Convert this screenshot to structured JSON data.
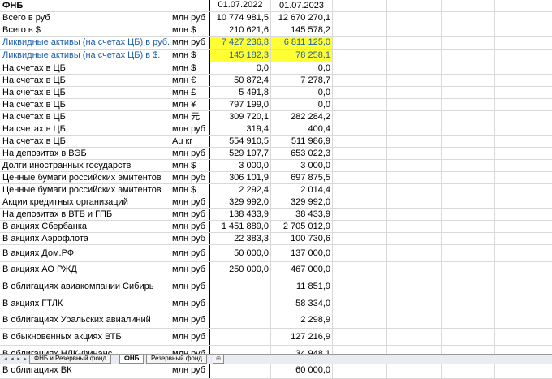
{
  "header": {
    "title": "ФНБ",
    "col1": "01.07.2022",
    "col2": "01.07.2023"
  },
  "rows": [
    {
      "label": "Всего в руб",
      "unit": "млн руб",
      "v1": "10 774 981,5",
      "v2": "12 670 270,1"
    },
    {
      "label": "Всего в $",
      "unit": "млн $",
      "v1": "210 621,6",
      "v2": "145 578,2"
    },
    {
      "label": "Ликвидные активы (на счетах ЦБ) в руб.",
      "unit": "млн руб",
      "v1": "7 427 236,8",
      "v2": "6 811 125,0",
      "blue": true,
      "highlight": true
    },
    {
      "label": "Ликвидные активы (на счетах ЦБ) в $.",
      "unit": "млн $",
      "v1": "145 182,3",
      "v2": "78 258,1",
      "blue": true,
      "highlight": true
    },
    {
      "label": "На счетах в ЦБ",
      "unit": "млн $",
      "v1": "0,0",
      "v2": "0,0"
    },
    {
      "label": "На счетах в ЦБ",
      "unit": "млн €",
      "v1": "50 872,4",
      "v2": "7 278,7"
    },
    {
      "label": "На счетах в ЦБ",
      "unit": "млн £",
      "v1": "5 491,8",
      "v2": "0,0"
    },
    {
      "label": "На счетах в ЦБ",
      "unit": "млн ¥",
      "v1": "797 199,0",
      "v2": "0,0"
    },
    {
      "label": "На счетах в ЦБ",
      "unit": "млн 元",
      "v1": "309 720,1",
      "v2": "282 284,2"
    },
    {
      "label": "На счетах в ЦБ",
      "unit": "млн руб",
      "v1": "319,4",
      "v2": "400,4"
    },
    {
      "label": "На счетах в ЦБ",
      "unit": "Au кг",
      "v1": "554 910,5",
      "v2": "511 986,9"
    },
    {
      "label": "На депозитах в ВЭБ",
      "unit": "млн руб",
      "v1": "529 197,7",
      "v2": "653 022,3"
    },
    {
      "label": "Долги иностранных государств",
      "unit": "млн $",
      "v1": "3 000,0",
      "v2": "3 000,0"
    },
    {
      "label": "Ценные бумаги российских эмитентов",
      "unit": "млн руб",
      "v1": "306 101,9",
      "v2": "697 875,5"
    },
    {
      "label": "Ценные бумаги российских эмитентов",
      "unit": "млн $",
      "v1": "2 292,4",
      "v2": "2 014,4"
    },
    {
      "label": "Акции кредитных организаций",
      "unit": "млн руб",
      "v1": "329 992,0",
      "v2": "329 992,0"
    },
    {
      "label": "На депозитах в ВТБ и ГПБ",
      "unit": "млн руб",
      "v1": "138 433,9",
      "v2": "38 433,9"
    },
    {
      "label": "В акциях Сбербанка",
      "unit": "млн руб",
      "v1": "1 451 889,0",
      "v2": "2 705 012,9"
    },
    {
      "label": "В акциях Аэрофлота",
      "unit": "млн руб",
      "v1": "22 383,3",
      "v2": "100 730,6"
    },
    {
      "label": "В акциях Дом.РФ",
      "unit": "млн руб",
      "v1": "50 000,0",
      "v2": "137 000,0"
    },
    {
      "label": "В акциях АО РЖД",
      "unit": "млн руб",
      "v1": "250 000,0",
      "v2": "467 000,0"
    },
    {
      "label": "В облигациях авиакомпании Сибирь",
      "unit": "млн руб",
      "v1": "",
      "v2": "11 851,9"
    },
    {
      "label": "В акциях ГТЛК",
      "unit": "млн руб",
      "v1": "",
      "v2": "58 334,0"
    },
    {
      "label": "В облигациях Уральских авиалиний",
      "unit": "млн руб",
      "v1": "",
      "v2": "2 298,9"
    },
    {
      "label": "В обыкновенных акциях ВТБ",
      "unit": "млн руб",
      "v1": "",
      "v2": "127 216,9"
    },
    {
      "label": "В облигациях НЛК-Финанс",
      "unit": "млн руб",
      "v1": "",
      "v2": "34 948,1"
    },
    {
      "label": "В облигациях ВК",
      "unit": "млн руб",
      "v1": "",
      "v2": "60 000,0"
    }
  ],
  "tabs": [
    {
      "label": "ФНБ и Резервный фонд",
      "active": false
    },
    {
      "label": "ФНБ",
      "active": true
    },
    {
      "label": "Резервный фонд",
      "active": false
    }
  ],
  "icons": {
    "nav_first": "nav-first-icon",
    "nav_prev": "nav-prev-icon",
    "nav_next": "nav-next-icon",
    "nav_last": "nav-last-icon",
    "new_sheet": "insert-sheet-icon"
  },
  "colors": {
    "link_text": "#1f5fa8",
    "highlight": "#ffff33",
    "tab_bar": "#e9ecf2"
  }
}
